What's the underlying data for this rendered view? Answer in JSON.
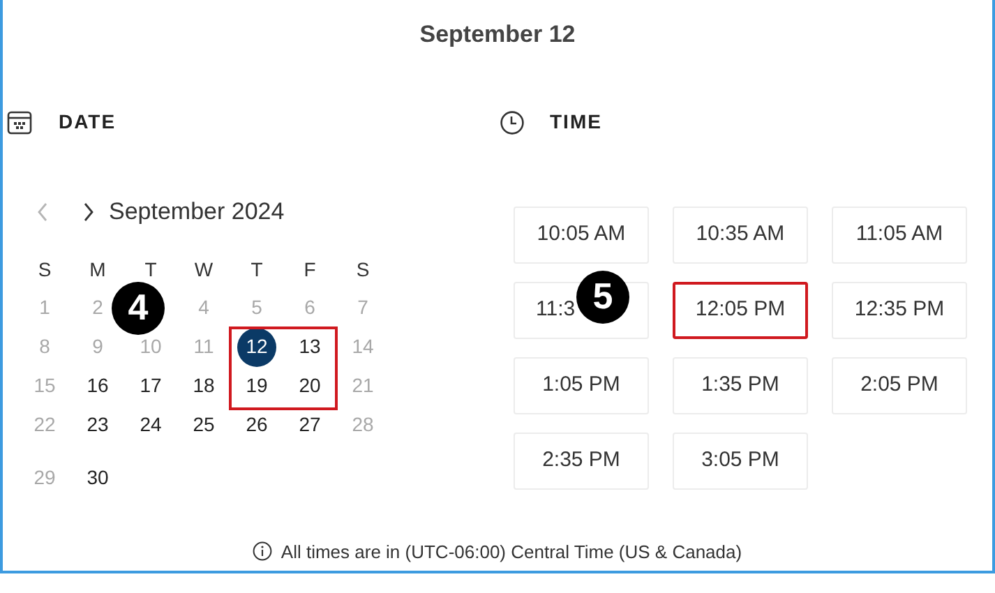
{
  "title": "September 12",
  "date_section": {
    "heading": "DATE"
  },
  "time_section": {
    "heading": "TIME"
  },
  "calendar": {
    "month": "September 2024",
    "prev_disabled": true,
    "weekdays": [
      "S",
      "M",
      "T",
      "W",
      "T",
      "F",
      "S"
    ],
    "weeks": [
      [
        {
          "day": "1",
          "available": false,
          "selected": false,
          "marked": false
        },
        {
          "day": "2",
          "available": false,
          "selected": false,
          "marked": false
        },
        {
          "kind": "callout",
          "label": "4"
        },
        {
          "day": "4",
          "available": false,
          "selected": false,
          "marked": false
        },
        {
          "day": "5",
          "available": false,
          "selected": false,
          "marked": false
        },
        {
          "day": "6",
          "available": false,
          "selected": false,
          "marked": false
        },
        {
          "day": "7",
          "available": false,
          "selected": false,
          "marked": false
        }
      ],
      [
        {
          "day": "8",
          "available": false,
          "selected": false,
          "marked": false
        },
        {
          "day": "9",
          "available": false,
          "selected": false,
          "marked": false
        },
        {
          "day": "10",
          "available": false,
          "selected": false,
          "marked": false
        },
        {
          "day": "11",
          "available": false,
          "selected": false,
          "marked": false
        },
        {
          "day": "12",
          "available": true,
          "selected": true,
          "marked": true
        },
        {
          "day": "13",
          "available": true,
          "selected": false,
          "marked": true
        },
        {
          "day": "14",
          "available": false,
          "selected": false,
          "marked": false
        }
      ],
      [
        {
          "day": "15",
          "available": false,
          "selected": false,
          "marked": false
        },
        {
          "day": "16",
          "available": true,
          "selected": false,
          "marked": false
        },
        {
          "day": "17",
          "available": true,
          "selected": false,
          "marked": false
        },
        {
          "day": "18",
          "available": true,
          "selected": false,
          "marked": false
        },
        {
          "day": "19",
          "available": true,
          "selected": false,
          "marked": true
        },
        {
          "day": "20",
          "available": true,
          "selected": false,
          "marked": true
        },
        {
          "day": "21",
          "available": false,
          "selected": false,
          "marked": false
        }
      ],
      [
        {
          "day": "22",
          "available": false,
          "selected": false,
          "marked": false
        },
        {
          "day": "23",
          "available": true,
          "selected": false,
          "marked": false
        },
        {
          "day": "24",
          "available": true,
          "selected": false,
          "marked": false
        },
        {
          "day": "25",
          "available": true,
          "selected": false,
          "marked": false
        },
        {
          "day": "26",
          "available": true,
          "selected": false,
          "marked": false
        },
        {
          "day": "27",
          "available": true,
          "selected": false,
          "marked": false
        },
        {
          "day": "28",
          "available": false,
          "selected": false,
          "marked": false
        }
      ],
      [
        {
          "day": "29",
          "available": false,
          "selected": false,
          "marked": false
        },
        {
          "day": "30",
          "available": true,
          "selected": false,
          "marked": false
        }
      ]
    ]
  },
  "times": [
    {
      "label": "10:05 AM",
      "marked": false
    },
    {
      "label": "10:35 AM",
      "marked": false
    },
    {
      "label": "11:05 AM",
      "marked": false
    },
    {
      "label": "11:3",
      "marked": false,
      "callout": "5"
    },
    {
      "label": "12:05 PM",
      "marked": true
    },
    {
      "label": "12:35 PM",
      "marked": false
    },
    {
      "label": "1:05 PM",
      "marked": false
    },
    {
      "label": "1:35 PM",
      "marked": false
    },
    {
      "label": "2:05 PM",
      "marked": false
    },
    {
      "label": "2:35 PM",
      "marked": false
    },
    {
      "label": "3:05 PM",
      "marked": false
    }
  ],
  "footer": "All times are in (UTC-06:00) Central Time (US & Canada)"
}
